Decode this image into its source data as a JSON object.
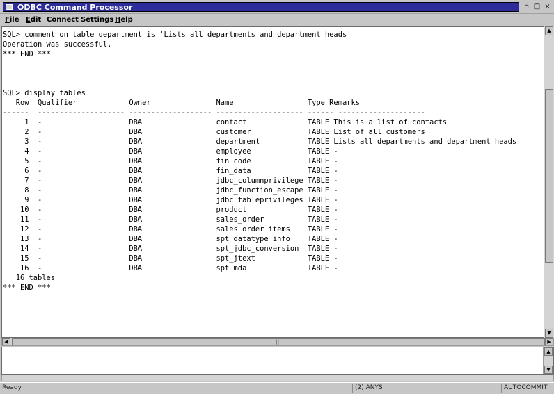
{
  "window": {
    "title": "ODBC Command Processor",
    "minimize_glyph": "▫",
    "maximize_glyph": "□",
    "close_glyph": "×"
  },
  "menu": [
    {
      "label": "File",
      "mnemonic": "F",
      "rest": "ile"
    },
    {
      "label": "Edit",
      "mnemonic": "E",
      "rest": "dit"
    },
    {
      "label": "Connect",
      "mnemonic": "",
      "rest": "Connect"
    },
    {
      "label": "Settings",
      "mnemonic": "",
      "rest": "Settings"
    },
    {
      "label": "Help",
      "mnemonic": "H",
      "rest": "elp"
    }
  ],
  "output": {
    "lines": [
      "SQL> comment on table department is 'Lists all departments and department heads'",
      "Operation was successful.",
      "*** END ***",
      "",
      "",
      "",
      "SQL> display tables",
      "   Row  Qualifier            Owner               Name                 Type Remarks",
      "------  -------------------- ------------------- -------------------- ------ --------------------",
      "     1  -                    DBA                 contact              TABLE This is a list of contacts",
      "     2  -                    DBA                 customer             TABLE List of all customers",
      "     3  -                    DBA                 department           TABLE Lists all departments and department heads",
      "     4  -                    DBA                 employee             TABLE -",
      "     5  -                    DBA                 fin_code             TABLE -",
      "     6  -                    DBA                 fin_data             TABLE -",
      "     7  -                    DBA                 jdbc_columnprivilege TABLE -",
      "     8  -                    DBA                 jdbc_function_escape TABLE -",
      "     9  -                    DBA                 jdbc_tableprivileges TABLE -",
      "    10  -                    DBA                 product              TABLE -",
      "    11  -                    DBA                 sales_order          TABLE -",
      "    12  -                    DBA                 sales_order_items    TABLE -",
      "    13  -                    DBA                 spt_datatype_info    TABLE -",
      "    14  -                    DBA                 spt_jdbc_conversion  TABLE -",
      "    15  -                    DBA                 spt_jtext            TABLE -",
      "    16  -                    DBA                 spt_mda              TABLE -",
      "   16 tables",
      "*** END ***"
    ]
  },
  "input": {
    "value": ""
  },
  "status": {
    "left": "Ready",
    "middle": "(2) ANYS",
    "right": "AUTOCOMMIT"
  },
  "scroll_arrows": {
    "up": "▲",
    "down": "▼",
    "left": "◀",
    "right": "▶",
    "grip": "|||"
  }
}
